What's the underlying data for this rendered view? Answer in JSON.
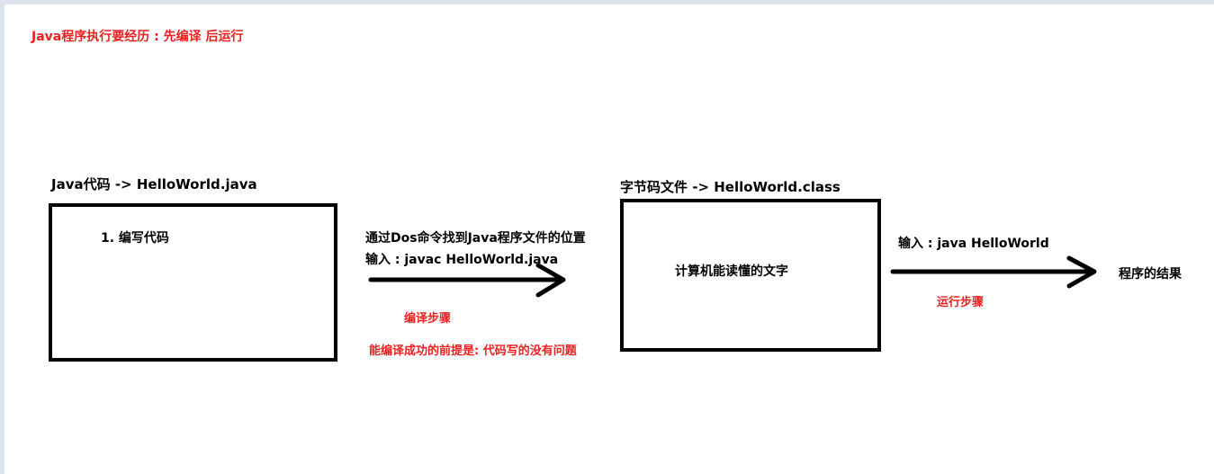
{
  "header": {
    "title": "Java程序执行要经历 : 先编译 后运行"
  },
  "source": {
    "label": "Java代码 -> HelloWorld.java",
    "box_text": "1. 编写代码"
  },
  "compile": {
    "line1": "通过Dos命令找到Java程序文件的位置",
    "line2": "输入 : javac HelloWorld.java",
    "step_label": "编译步骤",
    "precondition": "能编译成功的前提是: 代码写的没有问题"
  },
  "bytecode": {
    "label": "字节码文件 -> HelloWorld.class",
    "box_text": "计算机能读懂的文字"
  },
  "run": {
    "command": "输入 : java HelloWorld",
    "step_label": "运行步骤",
    "result": "程序的结果"
  },
  "colors": {
    "annotation_red": "#e8211f",
    "stroke": "#000000",
    "window_frame": "#dde3ec"
  }
}
